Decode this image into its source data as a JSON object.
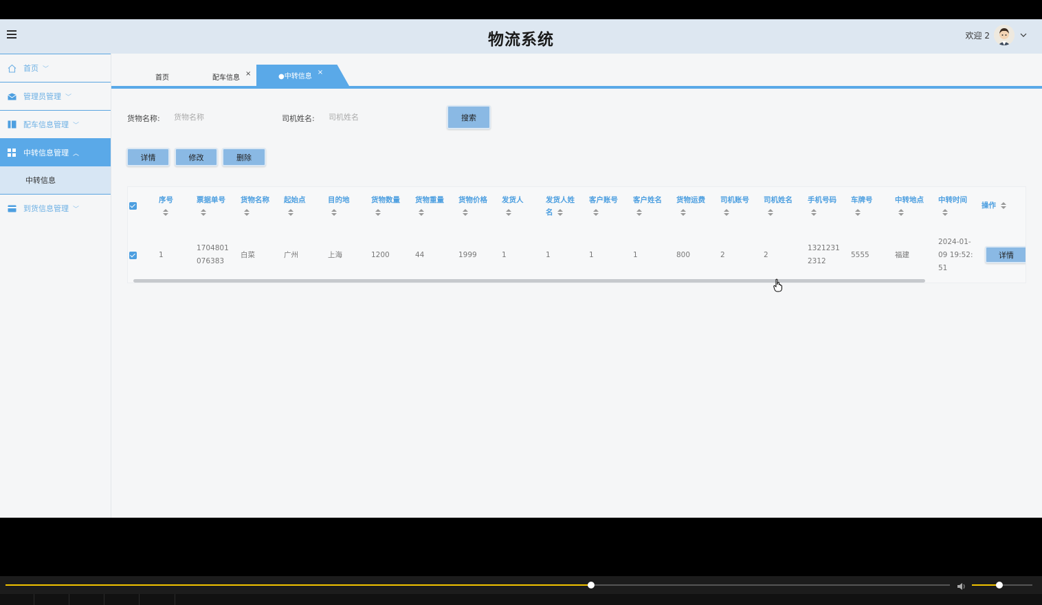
{
  "header": {
    "title": "物流系统",
    "welcome": "欢迎 2"
  },
  "sidebar": {
    "items": [
      {
        "label": "首页",
        "icon": "home-icon"
      },
      {
        "label": "管理员管理",
        "icon": "mail-icon"
      },
      {
        "label": "配车信息管理",
        "icon": "panel-icon"
      },
      {
        "label": "中转信息管理",
        "icon": "grid-icon"
      },
      {
        "label": "到货信息管理",
        "icon": "card-icon"
      }
    ],
    "sub_item": "中转信息"
  },
  "tabs": {
    "home": "首页",
    "peiche": "配车信息",
    "zhongzhuan": "●中转信息",
    "close": "×"
  },
  "search": {
    "goods_label": "货物名称:",
    "goods_placeholder": "货物名称",
    "driver_label": "司机姓名:",
    "driver_placeholder": "司机姓名",
    "search_button": "搜索"
  },
  "actions": {
    "detail": "详情",
    "edit": "修改",
    "delete": "删除"
  },
  "table": {
    "headers": {
      "xuhao": "序号",
      "piaoju": "票据单号",
      "huowu_mingcheng": "货物名称",
      "qishidian": "起始点",
      "mudidi": "目的地",
      "huowu_shuliang": "货物数量",
      "huowu_zhongliang": "货物重量",
      "huowu_jiage": "货物价格",
      "fahuoren": "发货人",
      "fahuoren_xingming_1": "发货人姓",
      "fahuoren_xingming_2": "名",
      "kehu_zhanghao": "客户账号",
      "kehu_xingming": "客户姓名",
      "huowu_yunfei": "货物运费",
      "siji_zhanghao": "司机账号",
      "siji_xingming": "司机姓名",
      "shouji": "手机号码",
      "chepai": "车牌号",
      "zhongzhuan_didian": "中转地点",
      "zhongzhuan_shijian": "中转时间",
      "caozuo": "操作"
    },
    "row": {
      "xuhao": "1",
      "piaoju_1": "1704801",
      "piaoju_2": "076383",
      "huowu_mingcheng": "白菜",
      "qishidian": "广州",
      "mudidi": "上海",
      "huowu_shuliang": "1200",
      "huowu_zhongliang": "44",
      "huowu_jiage": "1999",
      "fahuoren": "1",
      "fahuoren_xingming": "1",
      "kehu_zhanghao": "1",
      "kehu_xingming": "1",
      "huowu_yunfei": "800",
      "siji_zhanghao": "2",
      "siji_xingming": "2",
      "shouji_1": "1321231",
      "shouji_2": "2312",
      "chepai": "5555",
      "zhongzhuan_didian": "福建",
      "shijian_1": "2024-01-",
      "shijian_2": "09 19:52:",
      "shijian_3": "51",
      "detail_button": "详情"
    }
  },
  "player": {
    "progress": 0.62,
    "volume": 0.45
  },
  "colors": {
    "accent": "#5aa9e8",
    "header_bg": "#dde7f1",
    "button_bg": "#8ab9e4",
    "progress": "#f2c400"
  }
}
